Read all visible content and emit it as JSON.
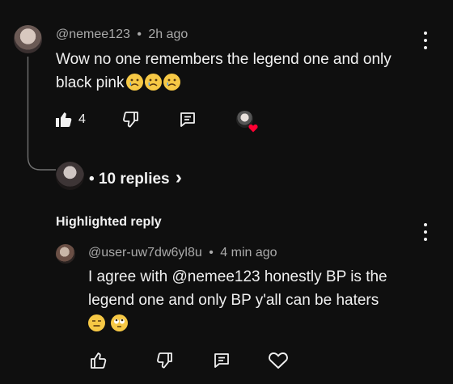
{
  "comment": {
    "author": "@nemee123",
    "time": "2h ago",
    "text": "Wow no one remembers  the legend one and only black pink",
    "emojis": [
      "crying-face",
      "crying-face",
      "crying-face"
    ],
    "like_count": "4"
  },
  "replies": {
    "label": "10 replies",
    "chevron": "›"
  },
  "highlighted": {
    "label": "Highlighted reply",
    "author": "@user-uw7dw6yl8u",
    "time": "4 min ago",
    "line1": "I agree with @nemee123 honestly BP is the",
    "line2": "legend one and only BP y'all can be haters",
    "emojis": [
      "expressionless-face",
      "face-with-rolling-eyes"
    ]
  },
  "separator": "•",
  "colors": {
    "background": "#0f0f0f",
    "text": "#f1f1f1",
    "meta": "#aaaaaa",
    "heart_badge": "#ff0033"
  }
}
